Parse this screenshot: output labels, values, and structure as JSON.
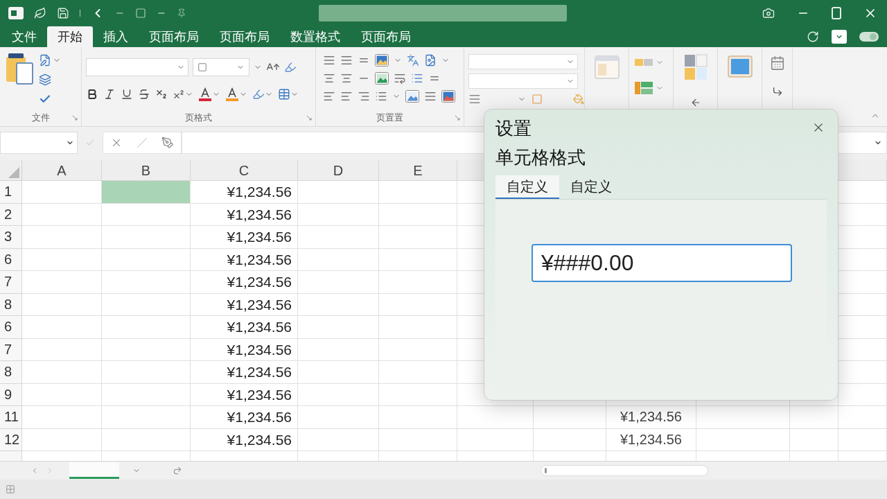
{
  "ribbon_tabs": [
    {
      "label": "文件",
      "selected": false
    },
    {
      "label": "开始",
      "selected": true
    },
    {
      "label": "插入",
      "selected": false
    },
    {
      "label": "页面布局",
      "selected": false
    },
    {
      "label": "页面布局",
      "selected": false
    },
    {
      "label": "数置格式",
      "selected": false
    },
    {
      "label": "页面布局",
      "selected": false
    }
  ],
  "ribbon": {
    "groups": [
      {
        "kind": "clipboard",
        "label": "文件"
      },
      {
        "kind": "font",
        "label": "页格式"
      },
      {
        "kind": "alignment",
        "label": "页置置"
      },
      {
        "kind": "number"
      },
      {
        "kind": "styles"
      },
      {
        "kind": "cells"
      },
      {
        "kind": "editing"
      },
      {
        "kind": "view"
      },
      {
        "kind": "misc"
      }
    ]
  },
  "sheet": {
    "columns": [
      {
        "label": "A"
      },
      {
        "label": "B"
      },
      {
        "label": "C"
      },
      {
        "label": "D"
      },
      {
        "label": "E"
      }
    ],
    "rows": [
      {
        "number": "1",
        "b_selected": true,
        "column_c": "¥1,234.56"
      },
      {
        "number": "2",
        "b_selected": false,
        "column_c": "¥1,234.56"
      },
      {
        "number": "3",
        "b_selected": false,
        "column_c": "¥1,234.56"
      },
      {
        "number": "6",
        "b_selected": false,
        "column_c": "¥1,234.56"
      },
      {
        "number": "7",
        "b_selected": false,
        "column_c": "¥1,234.56"
      },
      {
        "number": "8",
        "b_selected": false,
        "column_c": "¥1,234.56"
      },
      {
        "number": "6",
        "b_selected": false,
        "column_c": "¥1,234.56"
      },
      {
        "number": "7",
        "b_selected": false,
        "column_c": "¥1,234.56"
      },
      {
        "number": "8",
        "b_selected": false,
        "column_c": "¥1,234.56"
      },
      {
        "number": "9",
        "b_selected": false,
        "column_c": "¥1,234.56"
      },
      {
        "number": "11",
        "b_selected": false,
        "column_c": "¥1,234.56",
        "column_h": "¥1,234.56"
      },
      {
        "number": "12",
        "b_selected": false,
        "column_c": "¥1,234.56",
        "column_h": "¥1,234.56"
      }
    ]
  },
  "sheet_tabs": [
    {
      "selected": true
    }
  ],
  "dialog": {
    "title": "设置",
    "subtitle": "单元格格式",
    "tabs": [
      {
        "label": "自定义",
        "selected": true
      },
      {
        "label": "自定义",
        "selected": false
      }
    ],
    "format_field": {
      "value": "¥###0.00"
    }
  }
}
